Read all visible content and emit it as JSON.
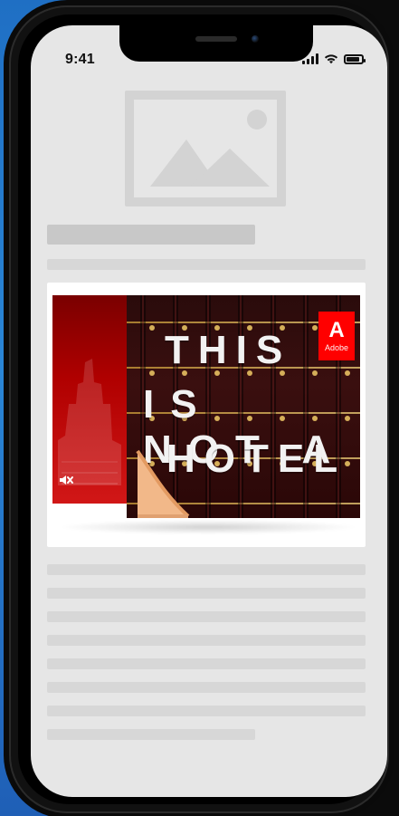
{
  "status_bar": {
    "time": "9:41",
    "icons": [
      "signal-icon",
      "wifi-icon",
      "battery-icon"
    ],
    "battery_level": 0.85
  },
  "promo": {
    "headline_lines": [
      "THIS",
      "IS NOT A",
      "HOTEL"
    ],
    "brand_mark": "A",
    "brand_name": "Adobe",
    "brand_color": "#ff0000",
    "icons": [
      "mute-icon",
      "image-placeholder-icon"
    ]
  }
}
